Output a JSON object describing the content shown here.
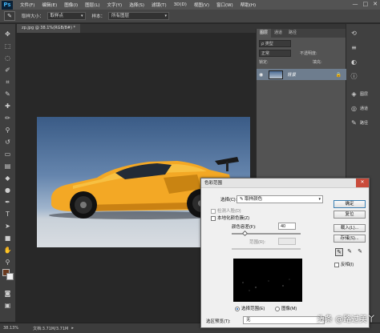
{
  "app": {
    "logo": "Ps"
  },
  "menu": [
    "文件(F)",
    "编辑(E)",
    "图像(I)",
    "图层(L)",
    "文字(Y)",
    "选择(S)",
    "滤镜(T)",
    "3D(D)",
    "视图(V)",
    "窗口(W)",
    "帮助(H)"
  ],
  "window_controls": {
    "minimize": "—",
    "maximize": "□",
    "close": "✕"
  },
  "options": {
    "sample_size_label": "取样大小：",
    "sample_size_value": "取样点",
    "sample_label": "样本：",
    "sample_value": "所有图层"
  },
  "document": {
    "tab": "zp.jpg @ 38.1%(RGB/8#) *"
  },
  "status": {
    "zoom": "38.13%",
    "doc_size": "文档:3.71M/3.71M"
  },
  "layers_panel": {
    "tabs": [
      "图层",
      "通道",
      "路径"
    ],
    "kind": "ρ 类型",
    "blend_mode": "正常",
    "opacity": "不透明度:",
    "lock": "锁定:",
    "fill": "填充:",
    "layer_name": "背景"
  },
  "dock": [
    {
      "icon": "layers-icon",
      "label": "图层"
    },
    {
      "icon": "channels-icon",
      "label": "通道"
    },
    {
      "icon": "paths-icon",
      "label": "路径"
    }
  ],
  "dialog": {
    "title": "色彩范围",
    "select_label": "选择(C):",
    "select_value": "取样颜色",
    "detect_faces": "检测人脸(D)",
    "localized": "本地化颜色簇(Z)",
    "fuzziness_label": "颜色容差(F):",
    "fuzziness_value": "40",
    "fuzziness_level": 0.2,
    "range_label": "范围(R):",
    "range_value": "",
    "mode_selection": "选择范围(E)",
    "mode_image": "图像(M)",
    "preview_label": "选区预览(T):",
    "preview_value": "无",
    "buttons": {
      "ok": "确定",
      "reset": "复位",
      "load": "载入(L)...",
      "save": "存储(S)..."
    },
    "invert": "反相(I)"
  },
  "watermark": "头条 @路过美丫"
}
